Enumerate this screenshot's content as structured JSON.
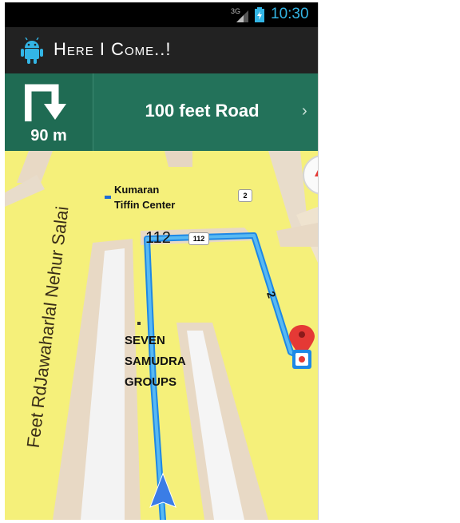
{
  "status_bar": {
    "network": "3G",
    "time": "10:30"
  },
  "action_bar": {
    "title": "Here I Come..!"
  },
  "navigation": {
    "turn_distance": "90 m",
    "road_name": "100 feet Road"
  },
  "map": {
    "labels": {
      "place_1_line1": "Kumaran",
      "place_1_line2": "Tiffin Center",
      "route_number": "112",
      "shield_112": "112",
      "shield_2": "2",
      "route_2": "2",
      "place_2_line1": "SEVEN",
      "place_2_line2": "SAMUDRA",
      "place_2_line3": "GROUPS",
      "street_name": "Feet RdJawaharlal Nehur Salai"
    }
  },
  "colors": {
    "route": "#3ea6ea",
    "map_bg": "#f5f07a",
    "banner": "#23725a",
    "pin": "#e53935"
  },
  "icons": [
    "android-icon",
    "turn-right-icon",
    "chevron-right-icon",
    "map-pin-icon",
    "navigation-arrow-icon",
    "compass-icon"
  ]
}
